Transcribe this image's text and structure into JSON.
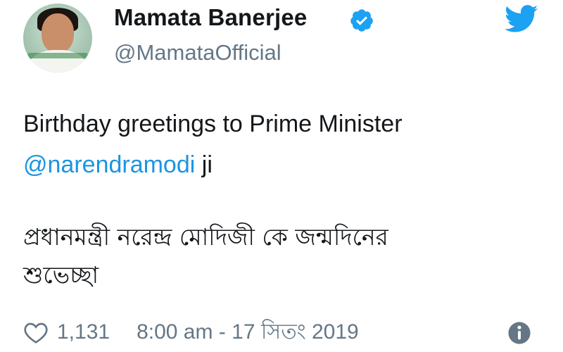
{
  "author": {
    "name": "Mamata Banerjee",
    "handle": "@MamataOfficial",
    "verified": true,
    "avatar_icon": "profile-photo"
  },
  "header_icons": {
    "verified_icon": "verified-badge-icon",
    "brand_icon": "twitter-bird-icon",
    "brand_color": "#1da1f2"
  },
  "tweet": {
    "line1": "Birthday greetings to Prime Minister",
    "mention": "@narendramodi",
    "mention_suffix": " ji",
    "bengali_line1": "প্রধানমন্ত্রী নরেন্দ্র মোদিজী কে জন্মদিনের",
    "bengali_line2": "শুভেচ্ছা",
    "mention_color": "#1b95e0"
  },
  "footer": {
    "like_count": "1,131",
    "timestamp": "8:00 am - 17 সিতং 2019",
    "like_icon": "heart-icon",
    "info_icon": "info-icon"
  }
}
